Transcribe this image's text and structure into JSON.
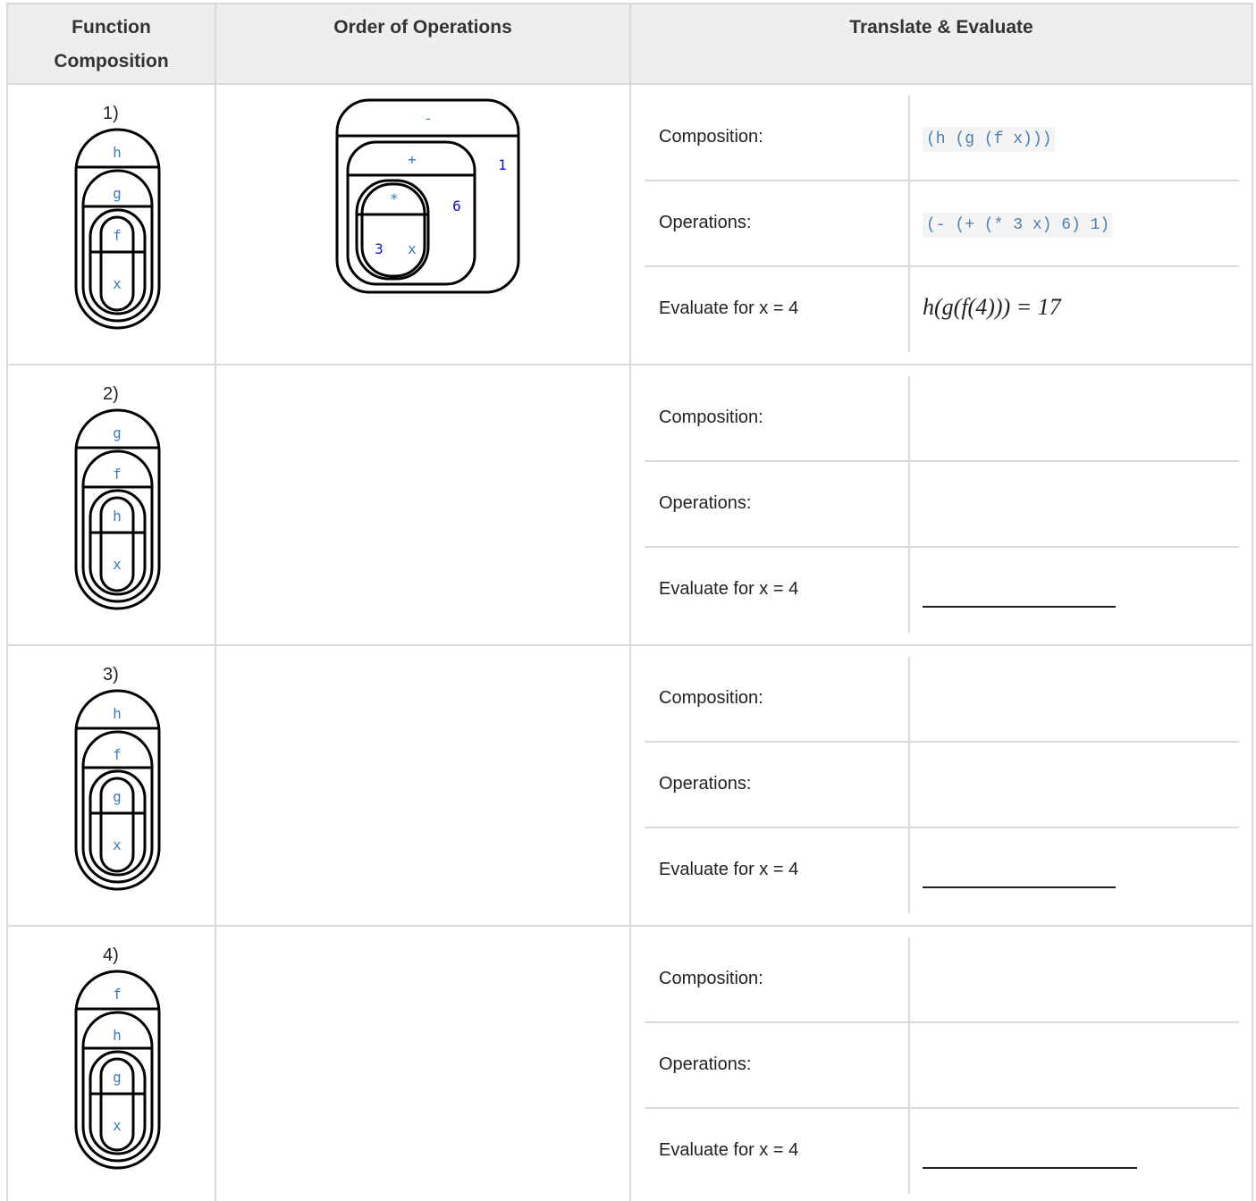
{
  "headers": {
    "col1": "Function Composition",
    "col1_line1": "Function",
    "col1_line2": "Composition",
    "col2": "Order of Operations",
    "col3": "Translate & Evaluate"
  },
  "labels": {
    "composition": "Composition:",
    "operations": "Operations:",
    "evaluate": "Evaluate for x = 4"
  },
  "rows": [
    {
      "number": "1)",
      "circles": [
        "h",
        "g",
        "f",
        "x"
      ]
    },
    {
      "number": "2)",
      "circles": [
        "g",
        "f",
        "h",
        "x"
      ]
    },
    {
      "number": "3)",
      "circles": [
        "h",
        "f",
        "g",
        "x"
      ]
    },
    {
      "number": "4)",
      "circles": [
        "f",
        "h",
        "g",
        "x"
      ]
    }
  ],
  "example": {
    "circle_ops": {
      "outer": "-",
      "outer_arg": "1",
      "middle": "+",
      "middle_arg": "6",
      "inner": "*",
      "inner_arg1": "3",
      "inner_arg2": "x"
    },
    "composition_code": "(h (g (f x)))",
    "operations_code": "(- (+ (* 3 x) 6) 1)",
    "evaluate_result": "h(g(f(4))) = 17"
  },
  "colors": {
    "code_keyword": "#4a7fb3",
    "circle_label": "#3a7abf",
    "oo_number": "#1010d0",
    "grid": "#d9d9d9",
    "header_bg": "#eeeeee"
  }
}
